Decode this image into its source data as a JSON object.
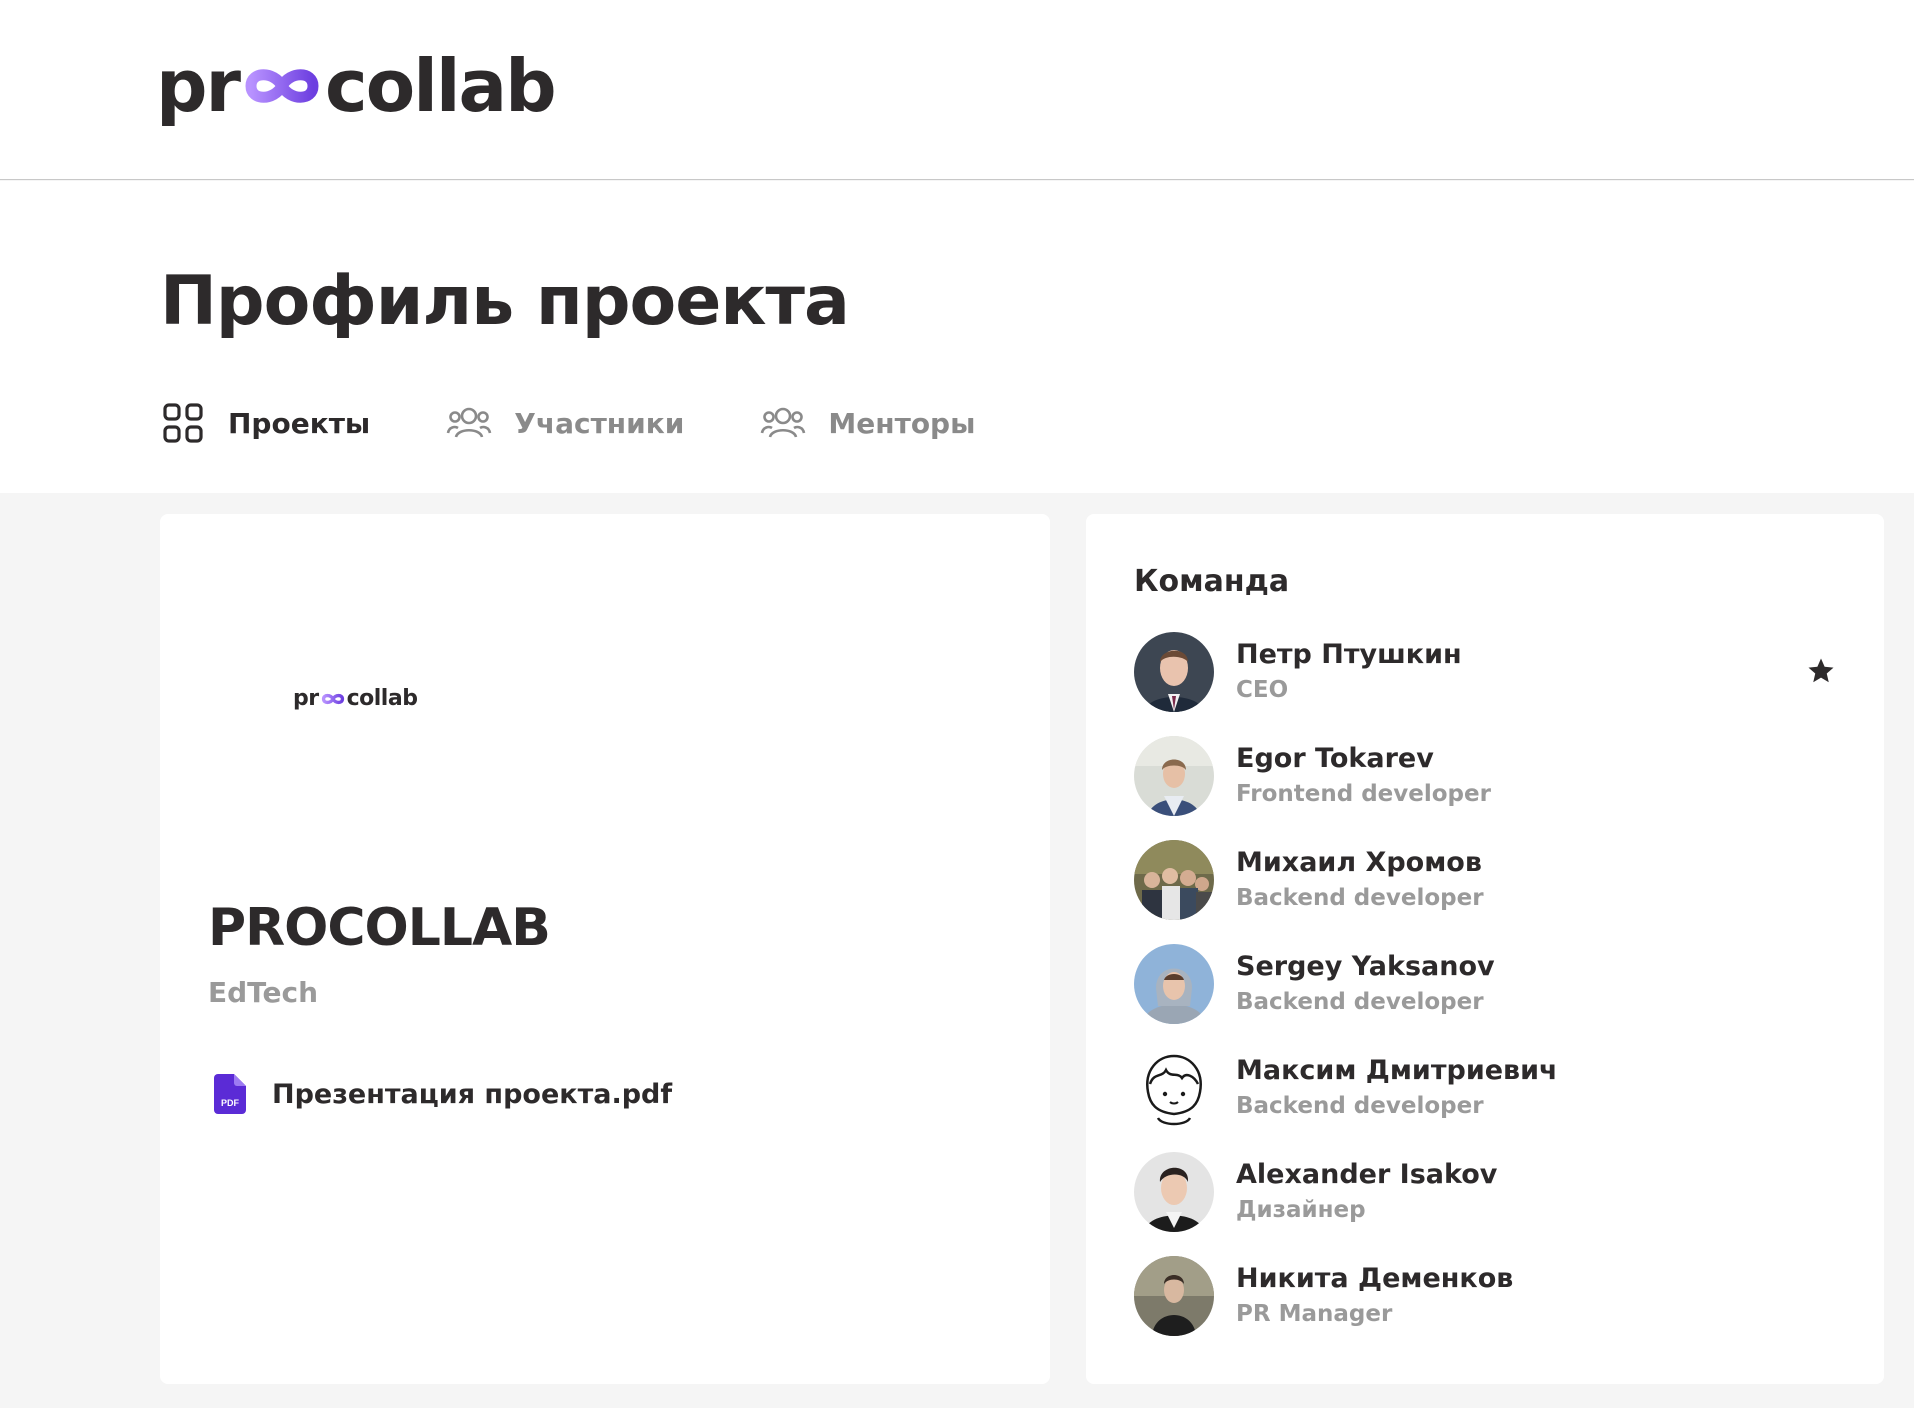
{
  "header": {
    "logo": {
      "left_text": "pr",
      "right_text": "collab",
      "icon": "infinity-logo-icon"
    }
  },
  "page": {
    "title": "Профиль проекта"
  },
  "tabs": [
    {
      "label": "Проекты",
      "icon": "grid-icon",
      "active": true
    },
    {
      "label": "Участники",
      "icon": "users-icon",
      "active": false
    },
    {
      "label": "Менторы",
      "icon": "users-icon",
      "active": false
    }
  ],
  "project": {
    "logo": {
      "left_text": "pr",
      "right_text": "collab"
    },
    "name": "PROCOLLAB",
    "industry": "EdTech",
    "file": {
      "name": "Презентация проекта.pdf",
      "icon": "pdf-file-icon",
      "badge": "PDF"
    }
  },
  "team": {
    "title": "Команда",
    "members": [
      {
        "name": "Петр Птушкин",
        "role": "CEO",
        "is_leader": true
      },
      {
        "name": "Egor Tokarev",
        "role": "Frontend developer",
        "is_leader": false
      },
      {
        "name": "Михаил Хромов",
        "role": "Backend developer",
        "is_leader": false
      },
      {
        "name": "Sergey Yaksanov",
        "role": "Backend developer",
        "is_leader": false
      },
      {
        "name": "Максим Дмитриевич",
        "role": "Backend developer",
        "is_leader": false
      },
      {
        "name": "Alexander Isakov",
        "role": "Дизайнер",
        "is_leader": false
      },
      {
        "name": "Никита Деменков",
        "role": "PR Manager",
        "is_leader": false
      }
    ]
  },
  "colors": {
    "brand_purple": "#8b5cf6",
    "brand_purple_dark": "#6d3fe0",
    "text_dark": "#2d2a2b",
    "text_muted": "#9a9a9a",
    "background": "#f5f5f5"
  }
}
